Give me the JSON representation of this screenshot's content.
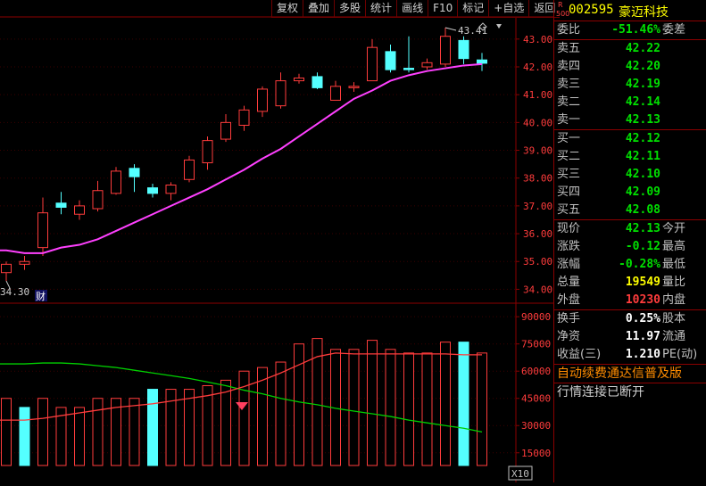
{
  "toolbar": {
    "buttons": [
      "复权",
      "叠加",
      "多股",
      "统计",
      "画线",
      "F10",
      "标记",
      "+自选",
      "返回"
    ]
  },
  "stock": {
    "badge_r": "R",
    "badge_500": "500",
    "code": "002595",
    "name": "豪迈科技"
  },
  "order_book": {
    "ratio_label": "委比",
    "ratio_value": "-51.46%",
    "diff_label": "委差",
    "asks": [
      {
        "label": "卖五",
        "price": "42.22"
      },
      {
        "label": "卖四",
        "price": "42.20"
      },
      {
        "label": "卖三",
        "price": "42.19"
      },
      {
        "label": "卖二",
        "price": "42.14"
      },
      {
        "label": "卖一",
        "price": "42.13"
      }
    ],
    "bids": [
      {
        "label": "买一",
        "price": "42.12"
      },
      {
        "label": "买二",
        "price": "42.11"
      },
      {
        "label": "买三",
        "price": "42.10"
      },
      {
        "label": "买四",
        "price": "42.09"
      },
      {
        "label": "买五",
        "price": "42.08"
      }
    ]
  },
  "stats": [
    {
      "label": "现价",
      "value": "42.13",
      "label2": "今开",
      "color": "green"
    },
    {
      "label": "涨跌",
      "value": "-0.12",
      "label2": "最高",
      "color": "green"
    },
    {
      "label": "涨幅",
      "value": "-0.28%",
      "label2": "最低",
      "color": "green"
    },
    {
      "label": "总量",
      "value": "19549",
      "label2": "量比",
      "color": "yellow"
    },
    {
      "label": "外盘",
      "value": "10230",
      "label2": "内盘",
      "color": "red"
    }
  ],
  "stats2": [
    {
      "label": "换手",
      "value": "0.25%",
      "label2": "股本",
      "color": "white"
    },
    {
      "label": "净资",
      "value": "11.97",
      "label2": "流通",
      "color": "white"
    },
    {
      "label": "收益(三)",
      "value": "1.210",
      "label2": "PE(动)",
      "color": "white"
    }
  ],
  "notices": {
    "upgrade": "自动续费通达信普及版",
    "status": "行情连接已断开"
  },
  "colors": {
    "up": "#ff3c3c",
    "down": "#54ffff",
    "ma": "#ff40ff",
    "vol_ma1": "#00d000",
    "vol_ma2": "#ff3c3c",
    "grid": "#8b0000"
  },
  "chart_data": [
    {
      "type": "candlestick",
      "y_ticks": [
        "43.00",
        "42.00",
        "41.00",
        "40.00",
        "39.00",
        "38.00",
        "37.00",
        "36.00",
        "35.00",
        "34.00"
      ],
      "ylim": [
        33.5,
        43.7
      ],
      "annotations": {
        "high": "43.41",
        "low": "34.30",
        "event": "财"
      },
      "candles": [
        {
          "o": 34.6,
          "c": 34.9,
          "h": 35.0,
          "l": 34.3
        },
        {
          "o": 34.9,
          "c": 35.0,
          "h": 35.2,
          "l": 34.7
        },
        {
          "o": 35.5,
          "c": 36.75,
          "h": 37.3,
          "l": 35.2
        },
        {
          "o": 37.1,
          "c": 36.95,
          "h": 37.5,
          "l": 36.7
        },
        {
          "o": 36.7,
          "c": 37.0,
          "h": 37.2,
          "l": 36.5
        },
        {
          "o": 36.9,
          "c": 37.55,
          "h": 37.9,
          "l": 36.8
        },
        {
          "o": 37.45,
          "c": 38.25,
          "h": 38.4,
          "l": 37.4
        },
        {
          "o": 38.35,
          "c": 38.05,
          "h": 38.5,
          "l": 37.5
        },
        {
          "o": 37.65,
          "c": 37.45,
          "h": 37.8,
          "l": 37.3
        },
        {
          "o": 37.45,
          "c": 37.75,
          "h": 37.85,
          "l": 37.2
        },
        {
          "o": 37.95,
          "c": 38.65,
          "h": 38.8,
          "l": 37.85
        },
        {
          "o": 38.55,
          "c": 39.35,
          "h": 39.5,
          "l": 38.3
        },
        {
          "o": 39.4,
          "c": 40.0,
          "h": 40.3,
          "l": 39.3
        },
        {
          "o": 39.9,
          "c": 40.45,
          "h": 40.6,
          "l": 39.7
        },
        {
          "o": 40.4,
          "c": 41.2,
          "h": 41.3,
          "l": 40.2
        },
        {
          "o": 40.6,
          "c": 41.5,
          "h": 41.8,
          "l": 40.5
        },
        {
          "o": 41.5,
          "c": 41.6,
          "h": 41.75,
          "l": 41.4
        },
        {
          "o": 41.65,
          "c": 41.25,
          "h": 41.8,
          "l": 41.2
        },
        {
          "o": 40.8,
          "c": 41.3,
          "h": 41.5,
          "l": 40.8
        },
        {
          "o": 41.25,
          "c": 41.3,
          "h": 41.45,
          "l": 41.1
        },
        {
          "o": 41.5,
          "c": 42.7,
          "h": 43.0,
          "l": 41.5
        },
        {
          "o": 42.55,
          "c": 41.9,
          "h": 42.8,
          "l": 41.8
        },
        {
          "o": 41.95,
          "c": 41.9,
          "h": 43.1,
          "l": 41.8
        },
        {
          "o": 42.0,
          "c": 42.15,
          "h": 42.3,
          "l": 41.9
        },
        {
          "o": 42.1,
          "c": 43.1,
          "h": 43.41,
          "l": 42.0
        },
        {
          "o": 42.95,
          "c": 42.3,
          "h": 43.1,
          "l": 42.1
        },
        {
          "o": 42.25,
          "c": 42.13,
          "h": 42.5,
          "l": 41.85
        }
      ],
      "ma": [
        35.4,
        35.3,
        35.3,
        35.5,
        35.6,
        35.8,
        36.1,
        36.4,
        36.7,
        37.0,
        37.3,
        37.6,
        37.95,
        38.3,
        38.7,
        39.05,
        39.5,
        39.95,
        40.4,
        40.85,
        41.15,
        41.5,
        41.7,
        41.85,
        41.95,
        42.05,
        42.1
      ]
    },
    {
      "type": "bar",
      "y_ticks": [
        "90000",
        "75000",
        "60000",
        "45000",
        "30000",
        "15000"
      ],
      "ylim": [
        8000,
        95000
      ],
      "unit": "X10",
      "volumes": [
        45000,
        40000,
        45000,
        40000,
        40000,
        45000,
        45000,
        45000,
        50000,
        50000,
        50000,
        52000,
        55000,
        60000,
        62000,
        65000,
        75000,
        78000,
        72000,
        72000,
        77000,
        72000,
        70000,
        70000,
        76000,
        76000,
        70000
      ],
      "vol_colors": [
        "up",
        "down",
        "up",
        "up",
        "up",
        "up",
        "up",
        "up",
        "down",
        "up",
        "up",
        "up",
        "up",
        "up",
        "up",
        "up",
        "up",
        "up",
        "up",
        "up",
        "up",
        "up",
        "up",
        "up",
        "up",
        "down",
        "up"
      ],
      "vol_ma1": [
        64000,
        64000,
        64500,
        64500,
        64000,
        63000,
        62000,
        60500,
        59000,
        57500,
        56000,
        54000,
        52000,
        49500,
        47500,
        45000,
        43000,
        41500,
        39500,
        38000,
        36500,
        35000,
        33000,
        31500,
        30000,
        28500,
        26500
      ],
      "vol_ma2": [
        33000,
        33000,
        34000,
        35500,
        37000,
        38500,
        40000,
        41000,
        42000,
        43500,
        45000,
        46500,
        48500,
        51500,
        55000,
        59000,
        63500,
        68000,
        70000,
        69500,
        69500,
        69500,
        69500,
        69500,
        69500,
        69000,
        69000
      ]
    }
  ]
}
